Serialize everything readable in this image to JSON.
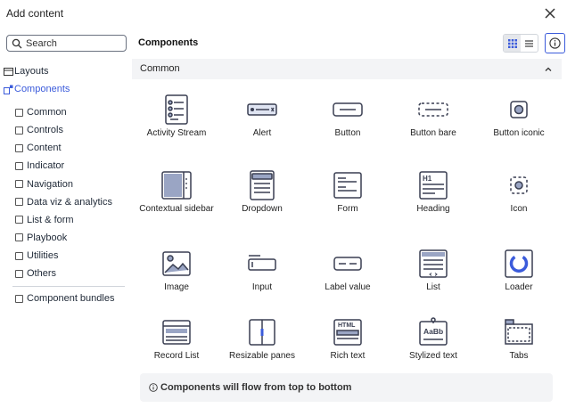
{
  "dialog": {
    "title": "Add content"
  },
  "search": {
    "placeholder": "Search"
  },
  "nav": [
    {
      "label": "Layouts",
      "icon": "layouts-icon"
    },
    {
      "label": "Components",
      "icon": "components-icon",
      "active": true
    }
  ],
  "filters": [
    "Common",
    "Controls",
    "Content",
    "Indicator",
    "Navigation",
    "Data viz & analytics",
    "List & form",
    "Playbook",
    "Utilities",
    "Others"
  ],
  "bundles": {
    "label": "Component bundles"
  },
  "main": {
    "title": "Components"
  },
  "section": {
    "label": "Common"
  },
  "components": [
    {
      "label": "Activity Stream",
      "icon": "activity-stream-icon"
    },
    {
      "label": "Alert",
      "icon": "alert-icon"
    },
    {
      "label": "Button",
      "icon": "button-icon"
    },
    {
      "label": "Button bare",
      "icon": "button-bare-icon"
    },
    {
      "label": "Button iconic",
      "icon": "button-iconic-icon"
    },
    {
      "label": "Contextual sidebar",
      "icon": "contextual-sidebar-icon"
    },
    {
      "label": "Dropdown",
      "icon": "dropdown-icon"
    },
    {
      "label": "Form",
      "icon": "form-icon"
    },
    {
      "label": "Heading",
      "icon": "heading-icon"
    },
    {
      "label": "Icon",
      "icon": "icon-icon"
    },
    {
      "label": "Image",
      "icon": "image-icon"
    },
    {
      "label": "Input",
      "icon": "input-icon"
    },
    {
      "label": "Label value",
      "icon": "label-value-icon"
    },
    {
      "label": "List",
      "icon": "list-icon"
    },
    {
      "label": "Loader",
      "icon": "loader-icon"
    },
    {
      "label": "Record List",
      "icon": "record-list-icon"
    },
    {
      "label": "Resizable panes",
      "icon": "resizable-panes-icon"
    },
    {
      "label": "Rich text",
      "icon": "rich-text-icon"
    },
    {
      "label": "Stylized text",
      "icon": "stylized-text-icon"
    },
    {
      "label": "Tabs",
      "icon": "tabs-icon"
    }
  ],
  "icon_glyphs": {
    "heading": "H1",
    "rich_text": "HTML",
    "stylized_text": "AaBb"
  },
  "footer": {
    "note": "Components will flow from top to bottom"
  },
  "colors": {
    "accent": "#3b5bdb",
    "icon_fill": "#9aa5c4",
    "icon_stroke": "#3a3f52"
  }
}
